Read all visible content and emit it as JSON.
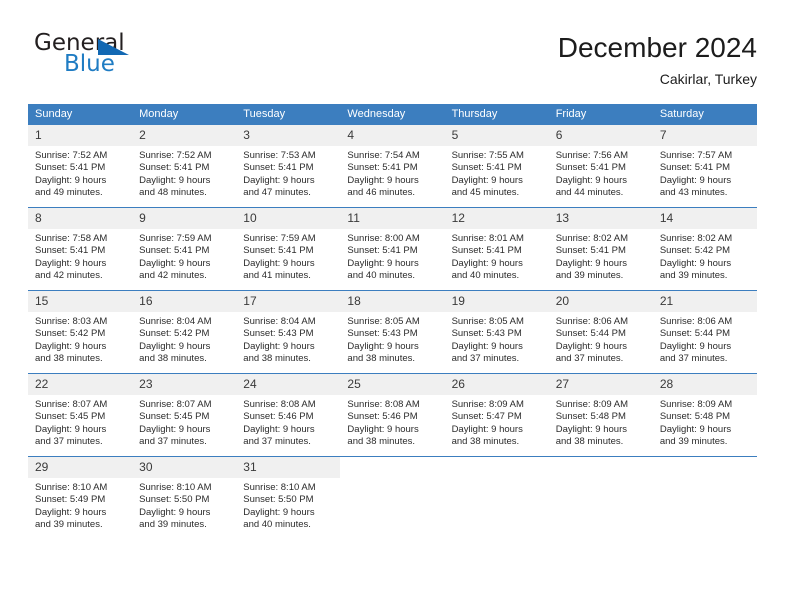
{
  "brand": {
    "name_top": "General",
    "name_bottom": "Blue",
    "triangle_icon": "triangle-icon",
    "color_primary": "#1268b3",
    "color_text": "#231f20"
  },
  "header": {
    "title": "December 2024",
    "subtitle": "Cakirlar, Turkey"
  },
  "theme": {
    "header_row_bg": "#3c7ebf",
    "daynum_bg": "#f0f0f0",
    "grid_line": "#3c7ebf",
    "page_bg": "#ffffff"
  },
  "calendar": {
    "weekday_headers": [
      "Sunday",
      "Monday",
      "Tuesday",
      "Wednesday",
      "Thursday",
      "Friday",
      "Saturday"
    ],
    "weeks": [
      [
        {
          "day": "1",
          "sunrise": "Sunrise: 7:52 AM",
          "sunset": "Sunset: 5:41 PM",
          "daylight_line1": "Daylight: 9 hours",
          "daylight_line2": "and 49 minutes."
        },
        {
          "day": "2",
          "sunrise": "Sunrise: 7:52 AM",
          "sunset": "Sunset: 5:41 PM",
          "daylight_line1": "Daylight: 9 hours",
          "daylight_line2": "and 48 minutes."
        },
        {
          "day": "3",
          "sunrise": "Sunrise: 7:53 AM",
          "sunset": "Sunset: 5:41 PM",
          "daylight_line1": "Daylight: 9 hours",
          "daylight_line2": "and 47 minutes."
        },
        {
          "day": "4",
          "sunrise": "Sunrise: 7:54 AM",
          "sunset": "Sunset: 5:41 PM",
          "daylight_line1": "Daylight: 9 hours",
          "daylight_line2": "and 46 minutes."
        },
        {
          "day": "5",
          "sunrise": "Sunrise: 7:55 AM",
          "sunset": "Sunset: 5:41 PM",
          "daylight_line1": "Daylight: 9 hours",
          "daylight_line2": "and 45 minutes."
        },
        {
          "day": "6",
          "sunrise": "Sunrise: 7:56 AM",
          "sunset": "Sunset: 5:41 PM",
          "daylight_line1": "Daylight: 9 hours",
          "daylight_line2": "and 44 minutes."
        },
        {
          "day": "7",
          "sunrise": "Sunrise: 7:57 AM",
          "sunset": "Sunset: 5:41 PM",
          "daylight_line1": "Daylight: 9 hours",
          "daylight_line2": "and 43 minutes."
        }
      ],
      [
        {
          "day": "8",
          "sunrise": "Sunrise: 7:58 AM",
          "sunset": "Sunset: 5:41 PM",
          "daylight_line1": "Daylight: 9 hours",
          "daylight_line2": "and 42 minutes."
        },
        {
          "day": "9",
          "sunrise": "Sunrise: 7:59 AM",
          "sunset": "Sunset: 5:41 PM",
          "daylight_line1": "Daylight: 9 hours",
          "daylight_line2": "and 42 minutes."
        },
        {
          "day": "10",
          "sunrise": "Sunrise: 7:59 AM",
          "sunset": "Sunset: 5:41 PM",
          "daylight_line1": "Daylight: 9 hours",
          "daylight_line2": "and 41 minutes."
        },
        {
          "day": "11",
          "sunrise": "Sunrise: 8:00 AM",
          "sunset": "Sunset: 5:41 PM",
          "daylight_line1": "Daylight: 9 hours",
          "daylight_line2": "and 40 minutes."
        },
        {
          "day": "12",
          "sunrise": "Sunrise: 8:01 AM",
          "sunset": "Sunset: 5:41 PM",
          "daylight_line1": "Daylight: 9 hours",
          "daylight_line2": "and 40 minutes."
        },
        {
          "day": "13",
          "sunrise": "Sunrise: 8:02 AM",
          "sunset": "Sunset: 5:41 PM",
          "daylight_line1": "Daylight: 9 hours",
          "daylight_line2": "and 39 minutes."
        },
        {
          "day": "14",
          "sunrise": "Sunrise: 8:02 AM",
          "sunset": "Sunset: 5:42 PM",
          "daylight_line1": "Daylight: 9 hours",
          "daylight_line2": "and 39 minutes."
        }
      ],
      [
        {
          "day": "15",
          "sunrise": "Sunrise: 8:03 AM",
          "sunset": "Sunset: 5:42 PM",
          "daylight_line1": "Daylight: 9 hours",
          "daylight_line2": "and 38 minutes."
        },
        {
          "day": "16",
          "sunrise": "Sunrise: 8:04 AM",
          "sunset": "Sunset: 5:42 PM",
          "daylight_line1": "Daylight: 9 hours",
          "daylight_line2": "and 38 minutes."
        },
        {
          "day": "17",
          "sunrise": "Sunrise: 8:04 AM",
          "sunset": "Sunset: 5:43 PM",
          "daylight_line1": "Daylight: 9 hours",
          "daylight_line2": "and 38 minutes."
        },
        {
          "day": "18",
          "sunrise": "Sunrise: 8:05 AM",
          "sunset": "Sunset: 5:43 PM",
          "daylight_line1": "Daylight: 9 hours",
          "daylight_line2": "and 38 minutes."
        },
        {
          "day": "19",
          "sunrise": "Sunrise: 8:05 AM",
          "sunset": "Sunset: 5:43 PM",
          "daylight_line1": "Daylight: 9 hours",
          "daylight_line2": "and 37 minutes."
        },
        {
          "day": "20",
          "sunrise": "Sunrise: 8:06 AM",
          "sunset": "Sunset: 5:44 PM",
          "daylight_line1": "Daylight: 9 hours",
          "daylight_line2": "and 37 minutes."
        },
        {
          "day": "21",
          "sunrise": "Sunrise: 8:06 AM",
          "sunset": "Sunset: 5:44 PM",
          "daylight_line1": "Daylight: 9 hours",
          "daylight_line2": "and 37 minutes."
        }
      ],
      [
        {
          "day": "22",
          "sunrise": "Sunrise: 8:07 AM",
          "sunset": "Sunset: 5:45 PM",
          "daylight_line1": "Daylight: 9 hours",
          "daylight_line2": "and 37 minutes."
        },
        {
          "day": "23",
          "sunrise": "Sunrise: 8:07 AM",
          "sunset": "Sunset: 5:45 PM",
          "daylight_line1": "Daylight: 9 hours",
          "daylight_line2": "and 37 minutes."
        },
        {
          "day": "24",
          "sunrise": "Sunrise: 8:08 AM",
          "sunset": "Sunset: 5:46 PM",
          "daylight_line1": "Daylight: 9 hours",
          "daylight_line2": "and 37 minutes."
        },
        {
          "day": "25",
          "sunrise": "Sunrise: 8:08 AM",
          "sunset": "Sunset: 5:46 PM",
          "daylight_line1": "Daylight: 9 hours",
          "daylight_line2": "and 38 minutes."
        },
        {
          "day": "26",
          "sunrise": "Sunrise: 8:09 AM",
          "sunset": "Sunset: 5:47 PM",
          "daylight_line1": "Daylight: 9 hours",
          "daylight_line2": "and 38 minutes."
        },
        {
          "day": "27",
          "sunrise": "Sunrise: 8:09 AM",
          "sunset": "Sunset: 5:48 PM",
          "daylight_line1": "Daylight: 9 hours",
          "daylight_line2": "and 38 minutes."
        },
        {
          "day": "28",
          "sunrise": "Sunrise: 8:09 AM",
          "sunset": "Sunset: 5:48 PM",
          "daylight_line1": "Daylight: 9 hours",
          "daylight_line2": "and 39 minutes."
        }
      ],
      [
        {
          "day": "29",
          "sunrise": "Sunrise: 8:10 AM",
          "sunset": "Sunset: 5:49 PM",
          "daylight_line1": "Daylight: 9 hours",
          "daylight_line2": "and 39 minutes."
        },
        {
          "day": "30",
          "sunrise": "Sunrise: 8:10 AM",
          "sunset": "Sunset: 5:50 PM",
          "daylight_line1": "Daylight: 9 hours",
          "daylight_line2": "and 39 minutes."
        },
        {
          "day": "31",
          "sunrise": "Sunrise: 8:10 AM",
          "sunset": "Sunset: 5:50 PM",
          "daylight_line1": "Daylight: 9 hours",
          "daylight_line2": "and 40 minutes."
        },
        {
          "day": "",
          "sunrise": "",
          "sunset": "",
          "daylight_line1": "",
          "daylight_line2": ""
        },
        {
          "day": "",
          "sunrise": "",
          "sunset": "",
          "daylight_line1": "",
          "daylight_line2": ""
        },
        {
          "day": "",
          "sunrise": "",
          "sunset": "",
          "daylight_line1": "",
          "daylight_line2": ""
        },
        {
          "day": "",
          "sunrise": "",
          "sunset": "",
          "daylight_line1": "",
          "daylight_line2": ""
        }
      ]
    ]
  }
}
